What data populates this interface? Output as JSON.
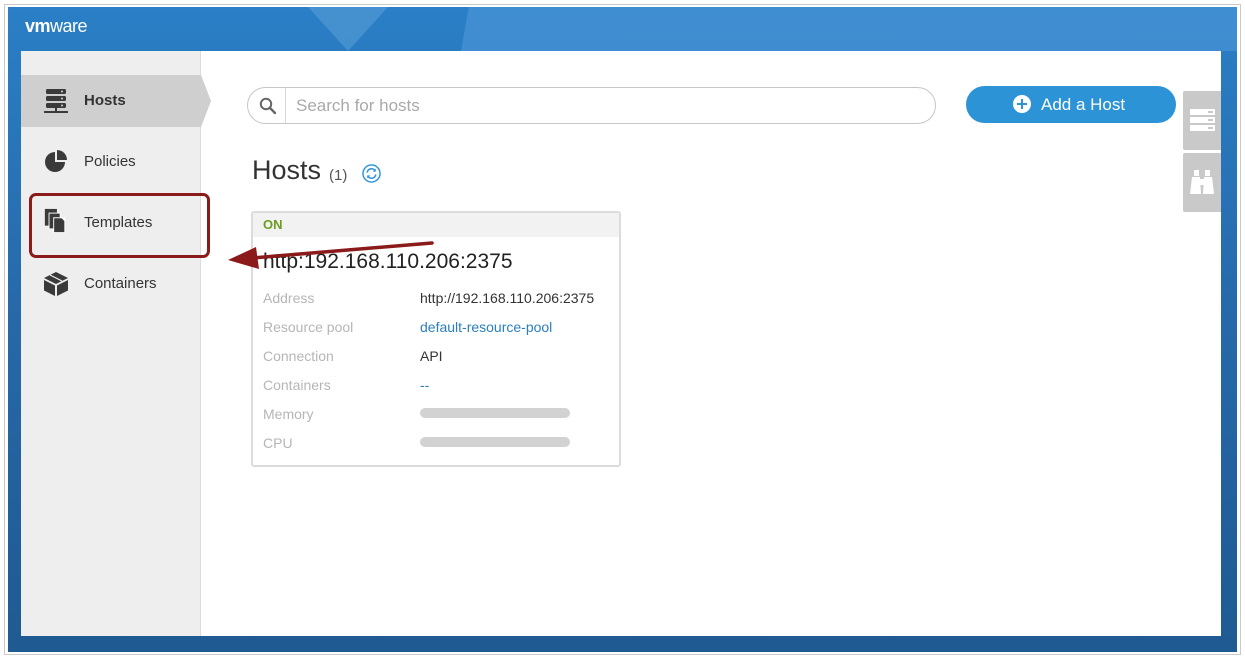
{
  "app": {
    "logo_prefix": "vm",
    "logo_suffix": "ware"
  },
  "sidebar": {
    "items": [
      {
        "label": "Hosts",
        "icon": "server-stack-icon",
        "active": true
      },
      {
        "label": "Policies",
        "icon": "pie-chart-icon",
        "active": false
      },
      {
        "label": "Templates",
        "icon": "documents-icon",
        "active": false
      },
      {
        "label": "Containers",
        "icon": "cube-icon",
        "active": false
      }
    ]
  },
  "search": {
    "placeholder": "Search for hosts",
    "value": ""
  },
  "toolbar": {
    "add_label": "Add a Host"
  },
  "hosts": {
    "title": "Hosts",
    "count": "(1)",
    "card": {
      "status": "ON",
      "name": "http:192.168.110.206:2375",
      "rows": [
        {
          "label": "Address",
          "value": "http://192.168.110.206:2375"
        },
        {
          "label": "Resource pool",
          "value": "default-resource-pool"
        },
        {
          "label": "Connection",
          "value": "API"
        },
        {
          "label": "Containers",
          "value": "--"
        },
        {
          "label": "Memory",
          "value": ""
        },
        {
          "label": "CPU",
          "value": ""
        }
      ]
    }
  },
  "colors": {
    "accent": "#2b93d6",
    "status_on": "#6a9d1f",
    "link": "#2b7fbf",
    "annotation": "#8b1a1a"
  }
}
